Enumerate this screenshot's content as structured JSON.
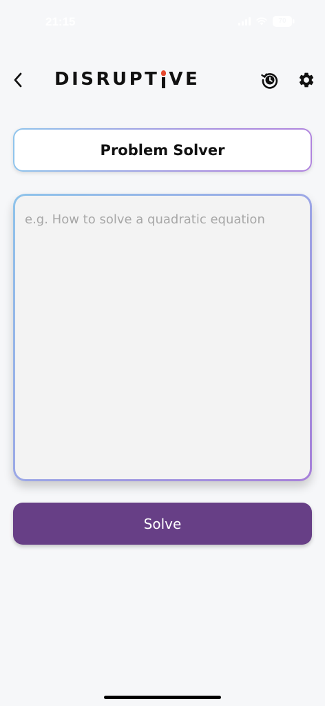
{
  "status_bar": {
    "time": "21:15",
    "battery": "70",
    "icons": [
      "signal-icon",
      "wifi-icon",
      "battery-icon"
    ]
  },
  "header": {
    "brand_prefix": "DISRUPT",
    "brand_suffix": "VE",
    "icons": {
      "back": "chevron-left-icon",
      "history": "history-icon",
      "settings": "gear-icon"
    }
  },
  "main": {
    "title": "Problem Solver",
    "input": {
      "value": "",
      "placeholder": "e.g. How to solve a quadratic equation"
    },
    "solve_label": "Solve"
  },
  "colors": {
    "background": "#f6f7f9",
    "primary": "#673f86",
    "gradient_start": "#8ec3ea",
    "gradient_end": "#a67fd9",
    "logo_accent": "#e5492e"
  }
}
